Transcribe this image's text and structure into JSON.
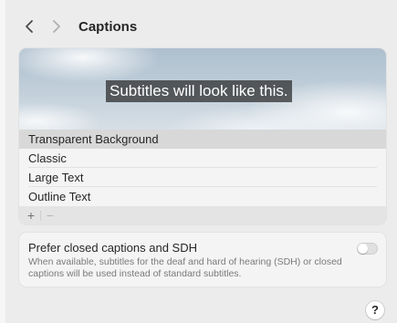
{
  "window": {
    "title": "Captions"
  },
  "nav": {
    "back_icon": "chevron-left-icon",
    "forward_icon": "chevron-right-icon"
  },
  "preview": {
    "sample_text": "Subtitles will look like this."
  },
  "styles": [
    {
      "label": "Transparent Background",
      "selected": true
    },
    {
      "label": "Classic",
      "selected": false
    },
    {
      "label": "Large Text",
      "selected": false
    },
    {
      "label": "Outline Text",
      "selected": false
    }
  ],
  "list_toolbar": {
    "add_label": "+",
    "remove_label": "−"
  },
  "sdh": {
    "title": "Prefer closed captions and SDH",
    "description": "When available, subtitles for the deaf and hard of hearing (SDH) or closed captions will be used instead of standard subtitles.",
    "enabled": false
  },
  "help": {
    "label": "?"
  },
  "colors": {
    "selected_row": "#d8d8d8",
    "card_bg": "#f4f4f4",
    "window_bg": "#ececec"
  }
}
